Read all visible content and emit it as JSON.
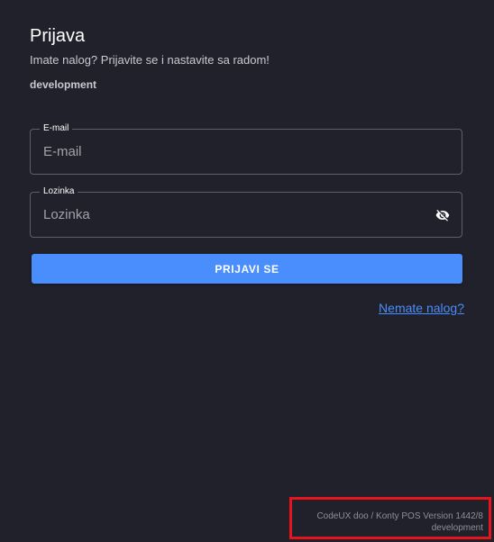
{
  "header": {
    "title": "Prijava",
    "subtitle": "Imate nalog? Prijavite se i nastavite sa radom!",
    "environment": "development"
  },
  "form": {
    "email": {
      "label": "E-mail",
      "placeholder": "E-mail",
      "value": ""
    },
    "password": {
      "label": "Lozinka",
      "placeholder": "Lozinka",
      "value": "",
      "toggle_icon": "eye-off-icon"
    },
    "submit_label": "PRIJAVI SE",
    "register_link": "Nemate nalog?"
  },
  "footer": {
    "version_line": "CodeUX doo / Konty POS Version 1442/8",
    "environment_line": "development"
  },
  "colors": {
    "background": "#20212b",
    "accent": "#4a8dfc",
    "highlight_border": "#e8141b"
  }
}
